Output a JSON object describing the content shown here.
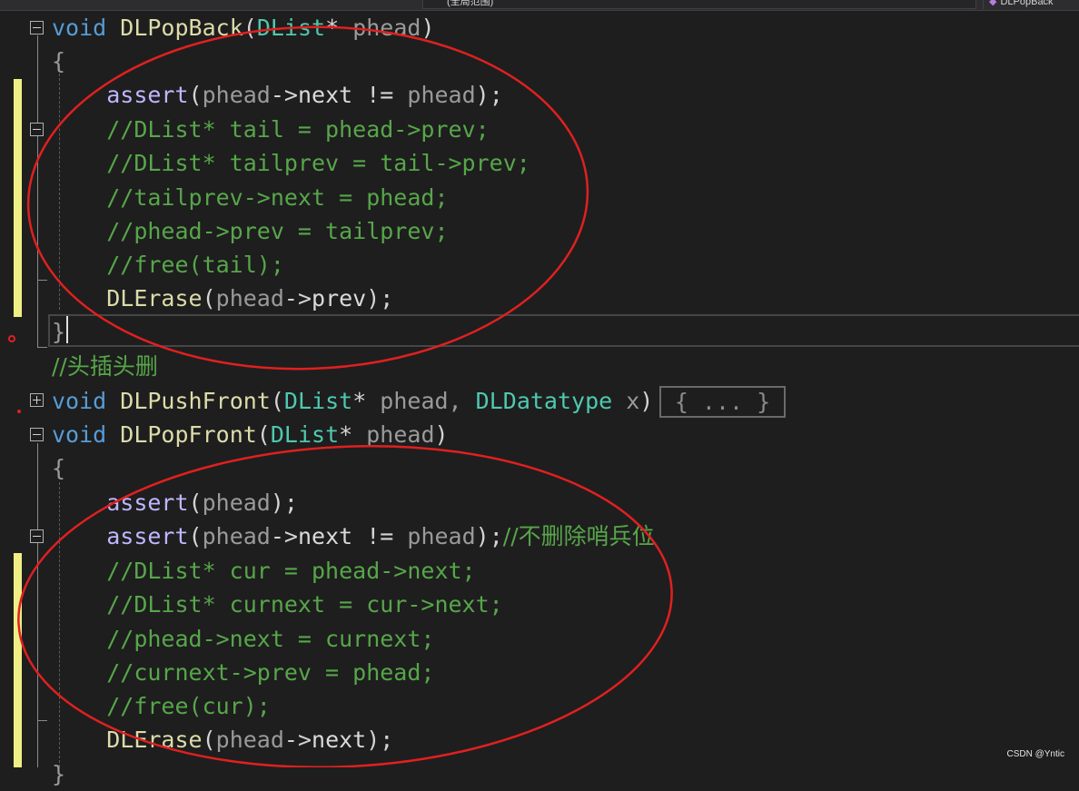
{
  "toolbar": {
    "scope_dropdown": "(全局范围)",
    "member_dropdown": "DLPopBack"
  },
  "code": {
    "popback_sig": {
      "kw": "void",
      "name": "DLPopBack",
      "open": "(",
      "type": "DList",
      "star": "*",
      "param": " phead",
      "close": ")"
    },
    "popback_open": "{",
    "popback_assert": {
      "macro": "assert",
      "open": "(",
      "p1": "phead",
      "arrow": "->",
      "member": "next",
      "op": " != ",
      "p2": "phead",
      "close": ");"
    },
    "popback_c1": "//DList* tail = phead->prev;",
    "popback_c2": "//DList* tailprev = tail->prev;",
    "popback_c3": "//tailprev->next = phead;",
    "popback_c4": "//phead->prev = tailprev;",
    "popback_c5": "//free(tail);",
    "popback_erase": {
      "fn": "DLErase",
      "open": "(",
      "p": "phead",
      "arrow": "->",
      "member": "prev",
      "close": ");"
    },
    "popback_close": "}",
    "comment_headinsert": "//头插头删",
    "pushfront_sig": {
      "kw": "void",
      "name": "DLPushFront",
      "open": "(",
      "type": "DList",
      "star": "*",
      "param": " phead, ",
      "type2": "DLDatatype",
      "param2": " x",
      "close": ")"
    },
    "pushfront_collapsed": "{ ... }",
    "popfront_sig": {
      "kw": "void",
      "name": "DLPopFront",
      "open": "(",
      "type": "DList",
      "star": "*",
      "param": " phead",
      "close": ")"
    },
    "popfront_open": "{",
    "popfront_assert1": {
      "macro": "assert",
      "open": "(",
      "p": "phead",
      "close": ");"
    },
    "popfront_assert2": {
      "macro": "assert",
      "open": "(",
      "p1": "phead",
      "arrow": "->",
      "member": "next",
      "op": " != ",
      "p2": "phead",
      "close": ");",
      "comment": "//不删除哨兵位"
    },
    "popfront_c1": "//DList* cur = phead->next;",
    "popfront_c2": "//DList* curnext = cur->next;",
    "popfront_c3": "//phead->next = curnext;",
    "popfront_c4": "//curnext->prev = phead;",
    "popfront_c5": "//free(cur);",
    "popfront_erase": {
      "fn": "DLErase",
      "open": "(",
      "p": "phead",
      "arrow": "->",
      "member": "next",
      "close": ");"
    },
    "popfront_close": "}"
  },
  "watermark": "CSDN @Yntic",
  "colors": {
    "background": "#1e1e1e",
    "keyword": "#569cd6",
    "function": "#dcdcaa",
    "type": "#4ec9b0",
    "parameter": "#9a9a9a",
    "comment": "#57a64a",
    "macro": "#beb7ff",
    "change_marker": "#efef86",
    "annotation_red": "#e02020"
  }
}
